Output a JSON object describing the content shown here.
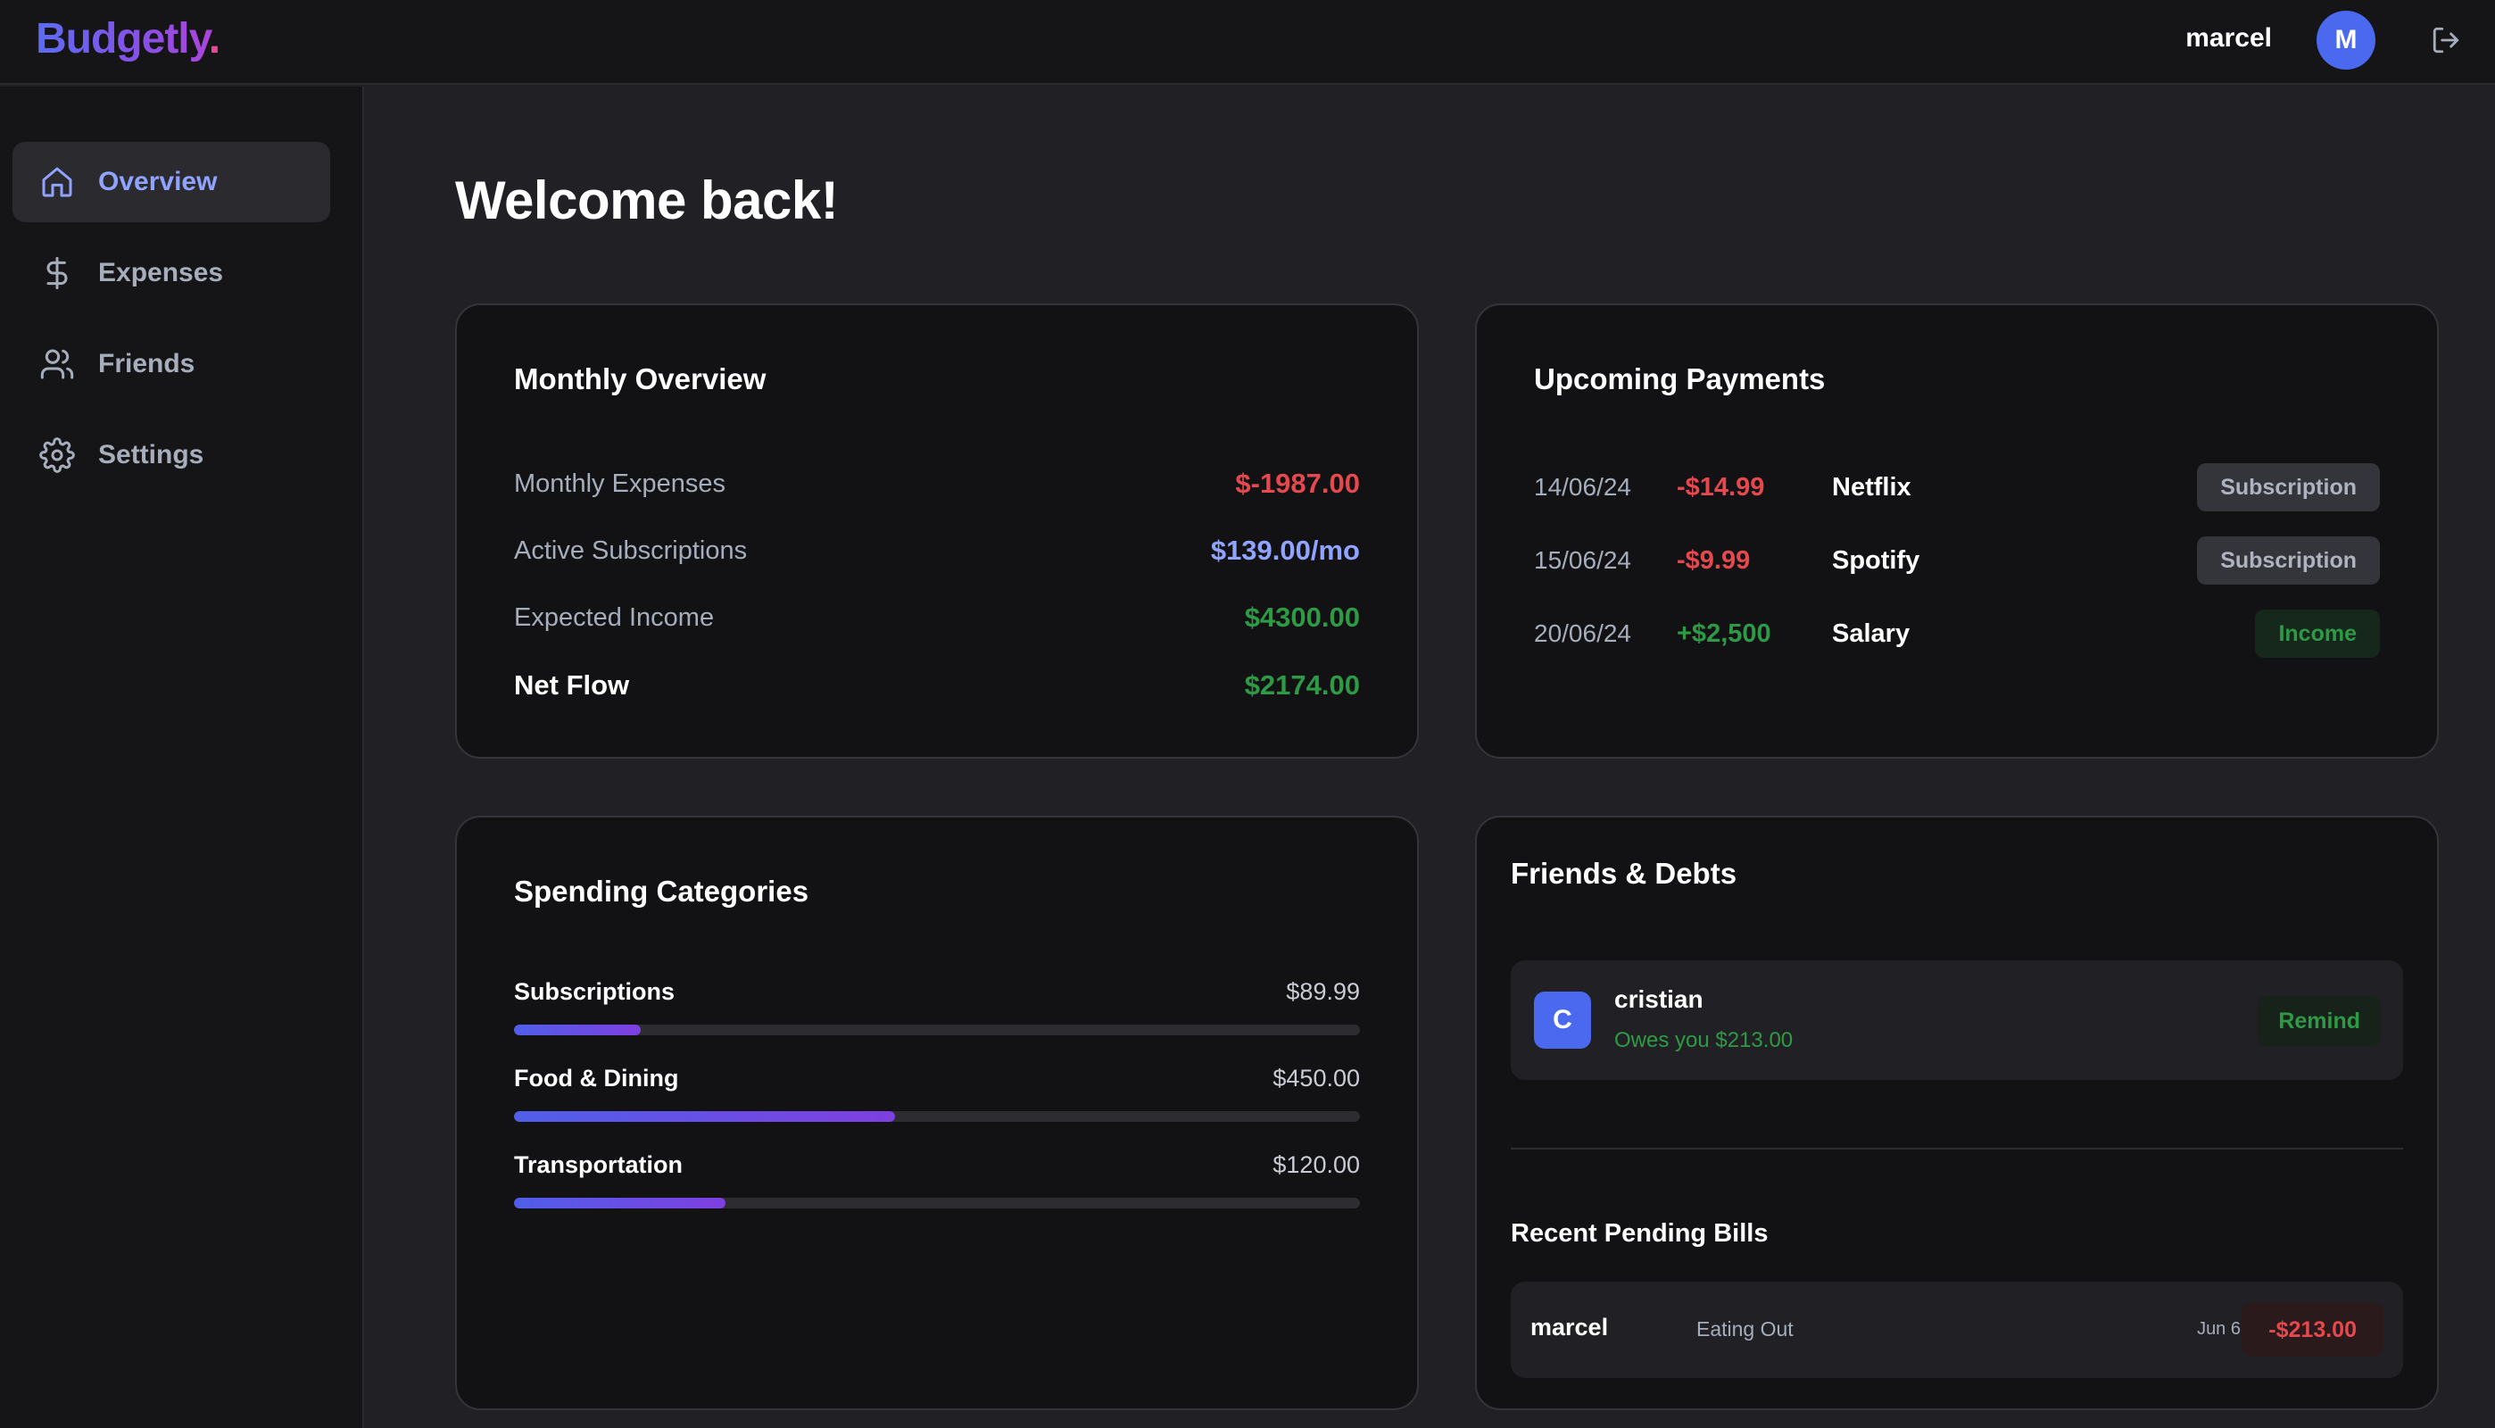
{
  "brand": {
    "name": "Budgetly",
    "dot": "."
  },
  "header": {
    "user_name": "marcel",
    "avatar_initial": "M"
  },
  "sidebar": {
    "items": [
      {
        "label": "Overview",
        "icon": "home-icon",
        "active": true
      },
      {
        "label": "Expenses",
        "icon": "dollar-icon",
        "active": false
      },
      {
        "label": "Friends",
        "icon": "users-icon",
        "active": false
      },
      {
        "label": "Settings",
        "icon": "gear-icon",
        "active": false
      }
    ]
  },
  "main": {
    "title": "Welcome back!"
  },
  "monthly_overview": {
    "title": "Monthly Overview",
    "rows": [
      {
        "label": "Monthly Expenses",
        "value": "$-1987.00"
      },
      {
        "label": "Active Subscriptions",
        "value": "$139.00/mo"
      },
      {
        "label": "Expected Income",
        "value": "$4300.00"
      },
      {
        "label": "Net Flow",
        "value": "$2174.00"
      }
    ]
  },
  "upcoming_payments": {
    "title": "Upcoming Payments",
    "rows": [
      {
        "date": "14/06/24",
        "amount": "-$14.99",
        "name": "Netflix",
        "type": "Subscription"
      },
      {
        "date": "15/06/24",
        "amount": "-$9.99",
        "name": "Spotify",
        "type": "Subscription"
      },
      {
        "date": "20/06/24",
        "amount": "+$2,500",
        "name": "Salary",
        "type": "Income"
      }
    ]
  },
  "spending_categories": {
    "title": "Spending Categories",
    "items": [
      {
        "name": "Subscriptions",
        "amount": "$89.99",
        "fraction": 0.15
      },
      {
        "name": "Food & Dining",
        "amount": "$450.00",
        "fraction": 0.45
      },
      {
        "name": "Transportation",
        "amount": "$120.00",
        "fraction": 0.25
      }
    ]
  },
  "friends_debts": {
    "title": "Friends & Debts",
    "friend": {
      "initial": "C",
      "name": "cristian",
      "status": "Owes you $213.00",
      "action": "Remind"
    },
    "bills_title": "Recent Pending Bills",
    "bill": {
      "name": "marcel",
      "category": "Eating Out",
      "date": "Jun 6",
      "amount": "-$213.00"
    }
  },
  "colors": {
    "accent": "#4a69ef",
    "negative": "#e5484d",
    "positive": "#2f9a45",
    "subscription": "#8fa3ff"
  }
}
